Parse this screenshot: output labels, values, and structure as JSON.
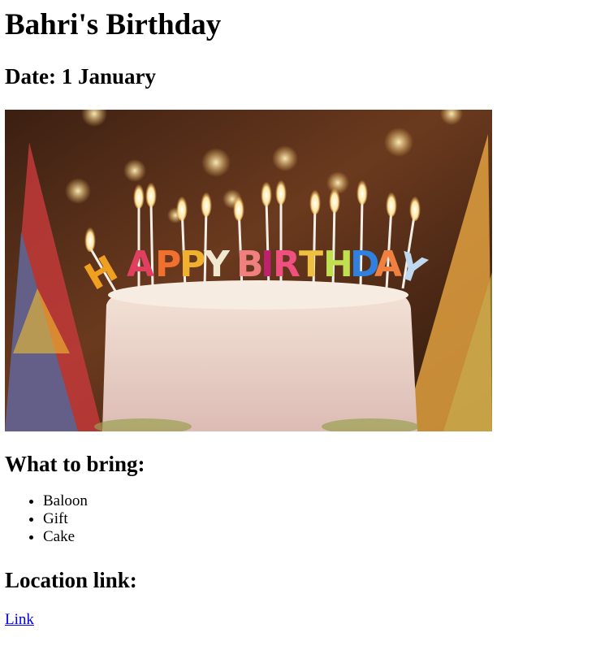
{
  "page": {
    "title": "Bahri's Birthday",
    "date_heading": "Date: 1 January",
    "image_alt": "birthday cake",
    "bring_heading": "What to bring:",
    "bring_items": [
      "Baloon",
      "Gift",
      "Cake"
    ],
    "location_heading": "Location link:",
    "location_link_label": "Link"
  },
  "image_content": {
    "candle_text": "HAPPY BIRTHDAY"
  }
}
